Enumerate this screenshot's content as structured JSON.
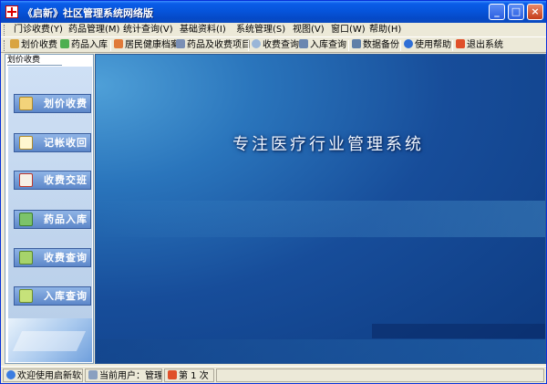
{
  "window": {
    "title": "《启新》社区管理系统网络版",
    "minimize": "_",
    "maximize": "□",
    "close": "×"
  },
  "menu": {
    "items": [
      {
        "label": "门诊收费(Y)"
      },
      {
        "label": "药品管理(M)"
      },
      {
        "label": "统计查询(V)"
      },
      {
        "label": "基础资料(I)"
      },
      {
        "label": "系统管理(S)"
      },
      {
        "label": "视图(V)"
      },
      {
        "label": "窗口(W)"
      },
      {
        "label": "帮助(H)"
      }
    ]
  },
  "toolbar": {
    "items": [
      {
        "label": "划价收费",
        "icon": "pen-icon"
      },
      {
        "label": "药品入库",
        "icon": "medicine-icon"
      },
      {
        "label": "居民健康档案",
        "icon": "health-record-icon"
      },
      {
        "label": "药品及收费项目",
        "icon": "items-icon"
      },
      {
        "label": "收费查询",
        "icon": "magnifier-icon"
      },
      {
        "label": "入库查询",
        "icon": "stock-query-icon"
      },
      {
        "label": "数据备份",
        "icon": "backup-icon"
      },
      {
        "label": "使用帮助",
        "icon": "help-icon"
      },
      {
        "label": "退出系统",
        "icon": "exit-icon"
      }
    ]
  },
  "sidebar": {
    "tab": "划价收费",
    "buttons": [
      {
        "label": "划价收费",
        "icon": "pricing-icon"
      },
      {
        "label": "记帐收回",
        "icon": "ledger-icon"
      },
      {
        "label": "收费交班",
        "icon": "handover-icon"
      },
      {
        "label": "药品入库",
        "icon": "stock-in-icon"
      },
      {
        "label": "收费查询",
        "icon": "fee-query-icon"
      },
      {
        "label": "入库查询",
        "icon": "stock-query-icon"
      }
    ]
  },
  "main": {
    "headline": "专注医疗行业管理系统"
  },
  "status": {
    "welcome": "欢迎使用启新软件",
    "user": "当前用户：管理员",
    "count": "第 1 次"
  },
  "colors": {
    "titlebar": "#0653D9",
    "main_bg": "#174d9a",
    "nav_button": "#5D87C9"
  }
}
